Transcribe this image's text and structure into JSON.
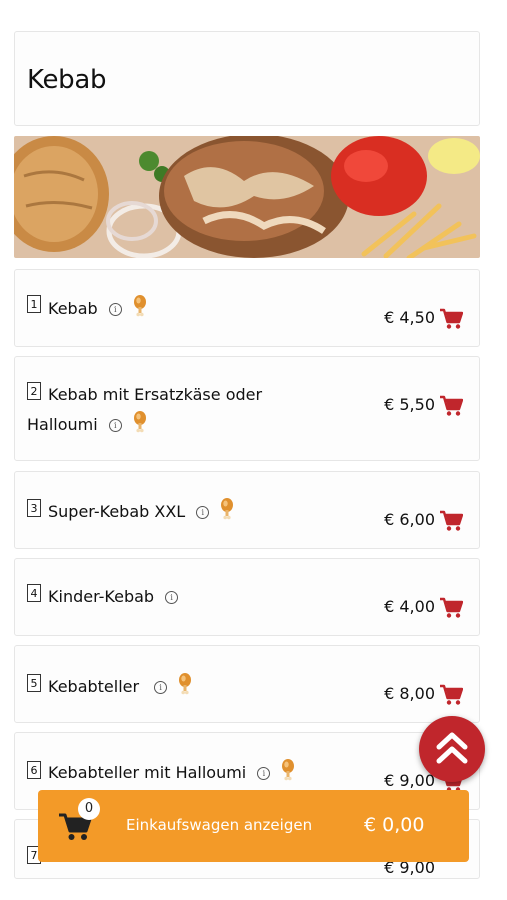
{
  "category": {
    "title": "Kebab"
  },
  "items": [
    {
      "num": "1",
      "name": "Kebab",
      "price": "€ 4,50"
    },
    {
      "num": "2",
      "name_line1": "Kebab mit Ersatzkäse oder",
      "name_line2": "Halloumi",
      "price": "€ 5,50"
    },
    {
      "num": "3",
      "name": "Super-Kebab XXL",
      "price": "€ 6,00"
    },
    {
      "num": "4",
      "name": "Kinder-Kebab",
      "price": "€ 4,00"
    },
    {
      "num": "5",
      "name": "Kebabteller",
      "price": "€ 8,00"
    },
    {
      "num": "6",
      "name": "Kebabteller mit Halloumi",
      "price": "€ 9,00"
    },
    {
      "num": "7",
      "price": "€ 9,00"
    }
  ],
  "info_symbol": "i",
  "cart": {
    "count": "0",
    "label": "Einkaufswagen anzeigen",
    "total": "€ 0,00"
  },
  "colors": {
    "accent_red": "#c0262c",
    "cart_orange": "#f39a28"
  },
  "icons": [
    "info-icon",
    "chicken-leg-icon",
    "add-to-cart-icon",
    "double-chevron-up-icon",
    "cart-icon"
  ]
}
